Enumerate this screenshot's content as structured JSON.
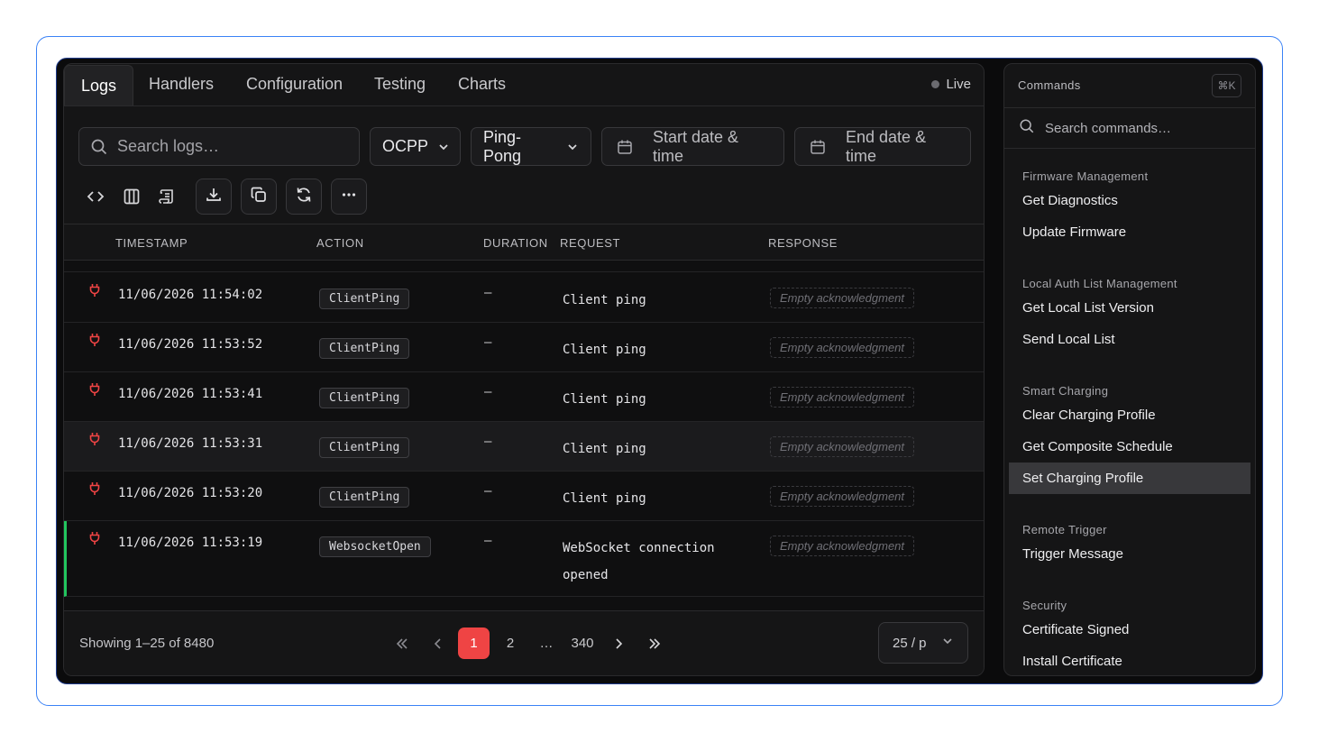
{
  "tabs": [
    {
      "label": "Logs",
      "active": true
    },
    {
      "label": "Handlers"
    },
    {
      "label": "Configuration"
    },
    {
      "label": "Testing"
    },
    {
      "label": "Charts"
    }
  ],
  "live_label": "Live",
  "filters": {
    "search_placeholder": "Search logs…",
    "protocol": "OCPP",
    "message_type": "Ping-Pong",
    "start_date_placeholder": "Start date & time",
    "end_date_placeholder": "End date & time"
  },
  "table": {
    "headers": {
      "timestamp": "TIMESTAMP",
      "action": "ACTION",
      "duration": "DURATION",
      "request": "REQUEST",
      "response": "RESPONSE"
    },
    "rows": [
      {
        "timestamp": "11/06/2026 11:54:02",
        "action": "ClientPing",
        "duration": "—",
        "request": "Client ping",
        "response": "Empty acknowledgment"
      },
      {
        "timestamp": "11/06/2026 11:53:52",
        "action": "ClientPing",
        "duration": "—",
        "request": "Client ping",
        "response": "Empty acknowledgment"
      },
      {
        "timestamp": "11/06/2026 11:53:41",
        "action": "ClientPing",
        "duration": "—",
        "request": "Client ping",
        "response": "Empty acknowledgment"
      },
      {
        "timestamp": "11/06/2026 11:53:31",
        "action": "ClientPing",
        "duration": "—",
        "request": "Client ping",
        "response": "Empty acknowledgment"
      },
      {
        "timestamp": "11/06/2026 11:53:20",
        "action": "ClientPing",
        "duration": "—",
        "request": "Client ping",
        "response": "Empty acknowledgment"
      },
      {
        "timestamp": "11/06/2026 11:53:19",
        "action": "WebsocketOpen",
        "duration": "—",
        "request": "WebSocket connection opened",
        "response": "Empty acknowledgment"
      }
    ]
  },
  "footer": {
    "showing": "Showing 1–25 of 8480",
    "pages": [
      "1",
      "2",
      "…",
      "340"
    ],
    "per_page": "25 / p"
  },
  "commands": {
    "title": "Commands",
    "shortcut": "⌘K",
    "search_placeholder": "Search commands…",
    "groups": [
      {
        "label": "Firmware Management",
        "items": [
          "Get Diagnostics",
          "Update Firmware"
        ]
      },
      {
        "label": "Local Auth List Management",
        "items": [
          "Get Local List Version",
          "Send Local List"
        ]
      },
      {
        "label": "Smart Charging",
        "items": [
          "Clear Charging Profile",
          "Get Composite Schedule",
          "Set Charging Profile"
        ]
      },
      {
        "label": "Remote Trigger",
        "items": [
          "Trigger Message"
        ]
      },
      {
        "label": "Security",
        "items": [
          "Certificate Signed",
          "Install Certificate"
        ]
      }
    ],
    "selected_item": "Set Charging Profile"
  },
  "colors": {
    "accent_red": "#ef4444",
    "accent_green": "#22c55e",
    "frame_blue": "#3b82f6"
  }
}
